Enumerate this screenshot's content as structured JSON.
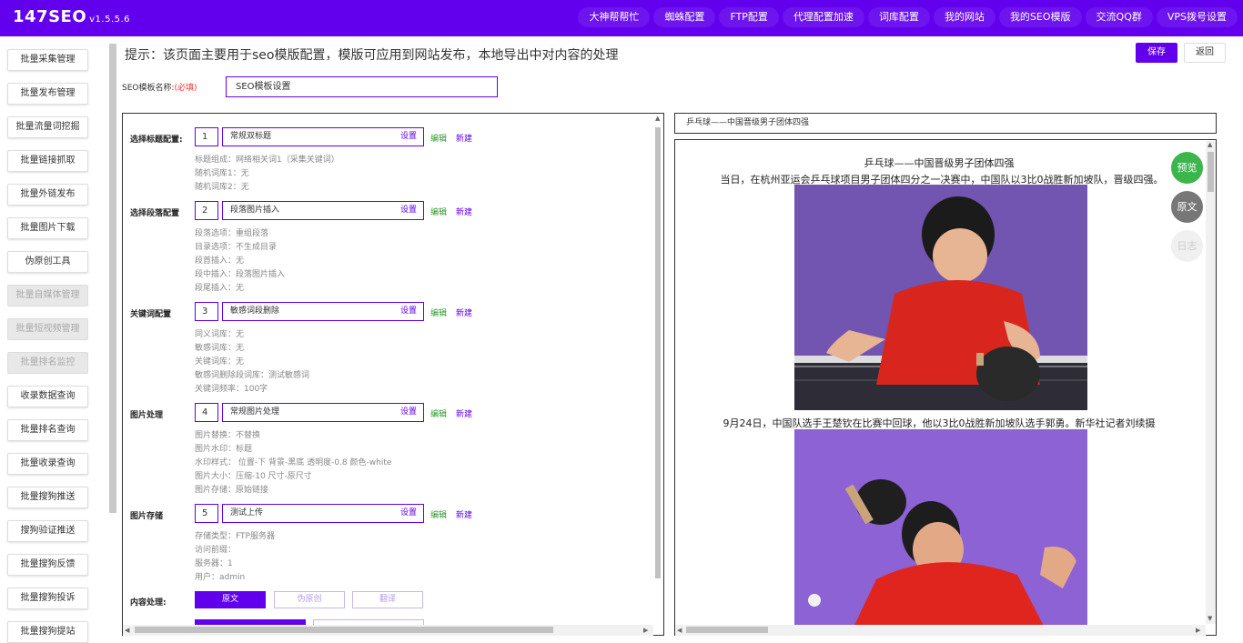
{
  "app": {
    "name": "147SEO",
    "version": "v1.5.5.6"
  },
  "nav": [
    "大神帮帮忙",
    "蜘蛛配置",
    "FTP配置",
    "代理配置加速",
    "词库配置",
    "我的网站",
    "我的SEO模版",
    "交流QQ群",
    "VPS拨号设置"
  ],
  "sidebar": [
    {
      "label": "批量采集管理",
      "disabled": false
    },
    {
      "label": "批量发布管理",
      "disabled": false
    },
    {
      "label": "批量流量词挖掘",
      "disabled": false
    },
    {
      "label": "批量链接抓取",
      "disabled": false
    },
    {
      "label": "批量外链发布",
      "disabled": false
    },
    {
      "label": "批量图片下载",
      "disabled": false
    },
    {
      "label": "伪原创工具",
      "disabled": false
    },
    {
      "label": "批量自媒体管理",
      "disabled": true
    },
    {
      "label": "批量短视频管理",
      "disabled": true
    },
    {
      "label": "批量排名监控",
      "disabled": true
    },
    {
      "label": "收录数据查询",
      "disabled": false
    },
    {
      "label": "批量排名查询",
      "disabled": false
    },
    {
      "label": "批量收录查询",
      "disabled": false
    },
    {
      "label": "批量搜狗推送",
      "disabled": false
    },
    {
      "label": "搜狗验证推送",
      "disabled": false
    },
    {
      "label": "批量搜狗反馈",
      "disabled": false
    },
    {
      "label": "批量搜狗投诉",
      "disabled": false
    },
    {
      "label": "批量搜狗提站",
      "disabled": false
    }
  ],
  "hint": "提示：该页面主要用于seo模版配置，模版可应用到网站发布，本地导出中对内容的处理",
  "actions": {
    "save": "保存",
    "back": "返回"
  },
  "template": {
    "label": "SEO模板名称:",
    "required": "(必填)",
    "value": "SEO模板设置"
  },
  "sections": [
    {
      "label": "选择标题配置:",
      "num": "1",
      "name": "常规双标题",
      "set": "设置",
      "edit": "编辑",
      "new": "新建",
      "details": [
        "标题组成：网络相关词1（采集关键词）",
        "随机词库1：无",
        "随机词库2：无"
      ]
    },
    {
      "label": "选择段落配置",
      "num": "2",
      "name": "段落图片插入",
      "set": "设置",
      "edit": "编辑",
      "new": "新建",
      "details": [
        "段落选项：重组段落",
        "目录选项：不生成目录",
        "段首插入：无",
        "段中插入：段落图片插入",
        "段尾插入：无"
      ]
    },
    {
      "label": "关键词配置",
      "num": "3",
      "name": "敏感词段删除",
      "set": "设置",
      "edit": "编辑",
      "new": "新建",
      "details": [
        "同义词库：无",
        "敏感词库：无",
        "关键词库：无",
        "敏感词删除段词库：测试敏感词",
        "关键词频率：100字"
      ]
    },
    {
      "label": "图片处理",
      "num": "4",
      "name": "常规图片处理",
      "set": "设置",
      "edit": "编辑",
      "new": "新建",
      "details": [
        "图片替换：不替换",
        "图片水印：标题",
        "水印样式： 位置-下 背景-黑底 透明度-0.8 颜色-white",
        "图片大小：压缩-10 尺寸-原尺寸",
        "图片存储：原始链接"
      ]
    },
    {
      "label": "图片存储",
      "num": "5",
      "name": "测试上传",
      "set": "设置",
      "edit": "编辑",
      "new": "新建",
      "details": [
        "存储类型：FTP服务器",
        "访问前缀：",
        "服务器：1",
        "用户：admin"
      ]
    }
  ],
  "content_processing": {
    "label": "内容处理:",
    "options": [
      "原文",
      "伪原创",
      "翻译"
    ],
    "active": "原文"
  },
  "preview": {
    "title_bar": "乒乓球——中国晋级男子团体四强",
    "title": "乒乓球——中国晋级男子团体四强",
    "line1": "当日，在杭州亚运会乒乓球项目男子团体四分之一决赛中，中国队以3比0战胜新加坡队，晋级四强。",
    "line2": "9月24日，中国队选手王楚钦在比赛中回球，他以3比0战胜新加坡队选手郭勇。新华社记者刘续摄"
  },
  "fabs": [
    "预览",
    "原文",
    "日志"
  ],
  "colors": {
    "brand": "#6200ee",
    "edit": "#2a9d2a",
    "required": "#e33",
    "fab_green": "#3cb54a"
  }
}
